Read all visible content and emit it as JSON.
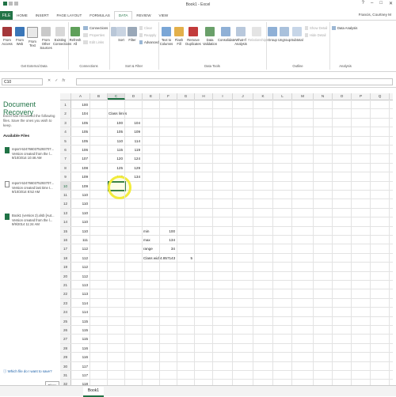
{
  "window": {
    "title": "Book1 - Excel",
    "user": "Francis, Courtney M"
  },
  "tabs": [
    {
      "label": "FILE"
    },
    {
      "label": "HOME"
    },
    {
      "label": "INSERT"
    },
    {
      "label": "PAGE LAYOUT"
    },
    {
      "label": "FORMULAS"
    },
    {
      "label": "DATA",
      "active": true
    },
    {
      "label": "REVIEW"
    },
    {
      "label": "VIEW"
    }
  ],
  "ribbon": {
    "get_external": {
      "group_label": "Get External Data",
      "buttons": [
        "From Access",
        "From Web",
        "From Text",
        "From Other Sources",
        "Existing Connections"
      ]
    },
    "connections": {
      "group_label": "Connections",
      "refresh": "Refresh All",
      "items": [
        "Connections",
        "Properties",
        "Edit Links"
      ]
    },
    "sort_filter": {
      "group_label": "Sort & Filter",
      "sort": "Sort",
      "filter": "Filter",
      "items": [
        "Clear",
        "Reapply",
        "Advanced"
      ]
    },
    "data_tools": {
      "group_label": "Data Tools",
      "buttons": [
        "Text to Columns",
        "Flash Fill",
        "Remove Duplicates",
        "Data Validation",
        "Consolidate",
        "What-If Analysis",
        "Relationships"
      ]
    },
    "outline": {
      "group_label": "Outline",
      "buttons": [
        "Group",
        "Ungroup",
        "Subtotal"
      ],
      "items": [
        "Show Detail",
        "Hide Detail"
      ]
    },
    "analysis": {
      "group_label": "Analysis",
      "item": "Data Analysis"
    }
  },
  "formula_bar": {
    "name_box": "C10",
    "content": ""
  },
  "recovery": {
    "title": "Document Recovery",
    "description": "Excel has recovered the following files. Save the ones you wish to keep.",
    "available_label": "Available Files",
    "files": [
      {
        "name": "report-5247660375293707...",
        "line2": "Version created from the l...",
        "line3": "9/10/2014 10:46 AM"
      },
      {
        "name": "report-5247660375293707...",
        "line2": "Version created last time t...",
        "line3": "9/10/2014 8:52 AM"
      },
      {
        "name": "Book1 (version 2).xlsb [Aut...",
        "line2": "Version created from the l...",
        "line3": "9/9/2014 11:24 AM"
      }
    ],
    "link": "Which file do I want to save?",
    "close": "Close"
  },
  "sheet": {
    "selected_cell": "C10",
    "columns": [
      "A",
      "B",
      "C",
      "D",
      "E",
      "F",
      "G",
      "H",
      "I",
      "J",
      "K",
      "L",
      "M",
      "N",
      "O",
      "P",
      "Q",
      "R"
    ],
    "rows": [
      {
        "n": "1",
        "a": "100"
      },
      {
        "n": "2",
        "a": "104",
        "c": "Class limits"
      },
      {
        "n": "3",
        "a": "105",
        "c": "100",
        "d": "104"
      },
      {
        "n": "4",
        "a": "105",
        "c": "105",
        "d": "109"
      },
      {
        "n": "5",
        "a": "105",
        "c": "110",
        "d": "114"
      },
      {
        "n": "6",
        "a": "106",
        "c": "115",
        "d": "119"
      },
      {
        "n": "7",
        "a": "107",
        "c": "120",
        "d": "124"
      },
      {
        "n": "8",
        "a": "108",
        "c": "125",
        "d": "129"
      },
      {
        "n": "9",
        "a": "109",
        "c": "130",
        "d": "134"
      },
      {
        "n": "10",
        "a": "109"
      },
      {
        "n": "11",
        "a": "110"
      },
      {
        "n": "12",
        "a": "110"
      },
      {
        "n": "13",
        "a": "110"
      },
      {
        "n": "14",
        "a": "110"
      },
      {
        "n": "15",
        "a": "110",
        "e": "min",
        "f": "100"
      },
      {
        "n": "16",
        "a": "111",
        "e": "max",
        "f": "134"
      },
      {
        "n": "17",
        "a": "112",
        "e": "range",
        "f": "34"
      },
      {
        "n": "18",
        "a": "112",
        "e": "Class widt",
        "f": "4.857143",
        "g": "5"
      },
      {
        "n": "19",
        "a": "112"
      },
      {
        "n": "20",
        "a": "112"
      },
      {
        "n": "21",
        "a": "113"
      },
      {
        "n": "22",
        "a": "113"
      },
      {
        "n": "23",
        "a": "114"
      },
      {
        "n": "24",
        "a": "114"
      },
      {
        "n": "25",
        "a": "115"
      },
      {
        "n": "26",
        "a": "115"
      },
      {
        "n": "27",
        "a": "115"
      },
      {
        "n": "28",
        "a": "116"
      },
      {
        "n": "29",
        "a": "116"
      },
      {
        "n": "30",
        "a": "117"
      },
      {
        "n": "31",
        "a": "117"
      },
      {
        "n": "32",
        "a": "118"
      }
    ],
    "tab_label": "Book1"
  },
  "colors": {
    "accent": "#217346",
    "highlight": "#f2ec3b",
    "link": "#1a5fa8"
  }
}
